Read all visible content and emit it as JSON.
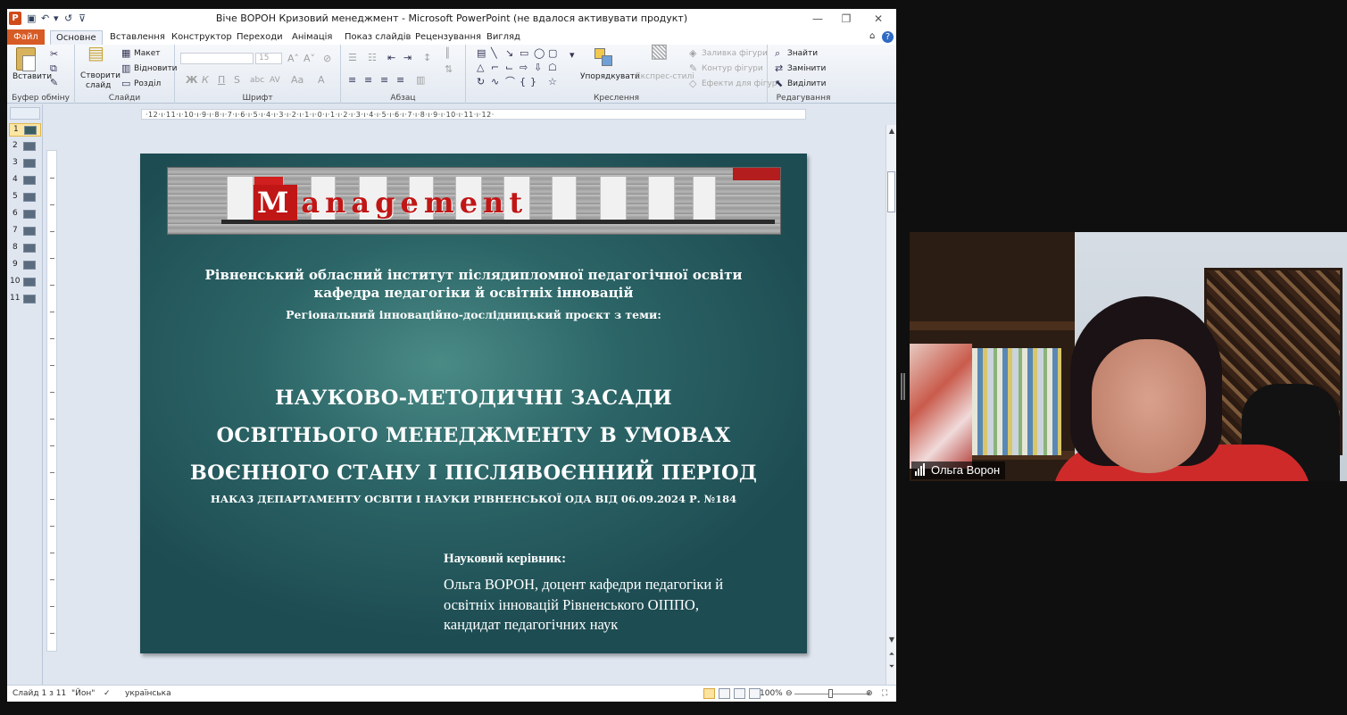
{
  "window": {
    "title": "Віче ВОРОН Кризовий менеджмент  -  Microsoft PowerPoint (не вдалося активувати продукт)",
    "app_icon": "P"
  },
  "tabs": {
    "file": "Файл",
    "items": [
      "Основне",
      "Вставлення",
      "Конструктор",
      "Переходи",
      "Анімація",
      "Показ слайдів",
      "Рецензування",
      "Вигляд"
    ]
  },
  "ribbon": {
    "clipboard": {
      "paste": "Вставити",
      "label": "Буфер обміну"
    },
    "slides": {
      "new_slide_1": "Створити",
      "new_slide_2": "слайд",
      "layout": "Макет",
      "reset": "Відновити",
      "section": "Розділ",
      "label": "Слайди"
    },
    "font": {
      "size": "15",
      "label": "Шрифт"
    },
    "paragraph": {
      "label": "Абзац"
    },
    "drawing": {
      "arrange": "Упорядкувати",
      "quick_styles": "Експрес-стилі",
      "fill": "Заливка фігури",
      "outline": "Контур фігури",
      "effects": "Ефекти для фігур",
      "label": "Креслення"
    },
    "editing": {
      "find": "Знайти",
      "replace": "Замінити",
      "select": "Виділити",
      "label": "Редагування"
    }
  },
  "ruler": "·12·ı·11·ı·10·ı·9·ı·8·ı·7·ı·6·ı·5·ı·4·ı·3·ı·2·ı·1·ı·0·ı·1·ı·2·ı·3·ı·4·ı·5·ı·6·ı·7·ı·8·ı·9·ı·10·ı·11·ı·12·",
  "thumbnails": [
    "1",
    "2",
    "3",
    "4",
    "5",
    "6",
    "7",
    "8",
    "9",
    "10",
    "11"
  ],
  "slide": {
    "banner_text": "anagement",
    "banner_cap": "M",
    "institute_line1": "Рівненський  обласний  інститут  післядипломної педагогічної освіти",
    "institute_line2": "кафедра педагогіки  й освітніх  інновацій",
    "project": "Регіональний інноваційно-дослідницький   проєкт  з теми:",
    "title_line1": "НАУКОВО-МЕТОДИЧНІ ЗАСАДИ",
    "title_line2": "ОСВІТНЬОГО МЕНЕДЖМЕНТУ В УМОВАХ",
    "title_line3": "ВОЄННОГО СТАНУ І ПІСЛЯВОЄННИЙ ПЕРІОД",
    "order": "НАКАЗ ДЕПАРТАМЕНТУ ОСВІТИ І НАУКИ РІВНЕНСЬКОЇ ОДА ВІД 06.09.2024 Р. №184",
    "supervisor_label": "Науковий керівник:",
    "supervisor_text": "Ольга ВОРОН, доцент кафедри педагогіки й\nосвітніх інновацій Рівненського ОІППО,\nкандидат педагогічних наук"
  },
  "status": {
    "slide_counter": "Слайд 1 з 11",
    "theme": "\"Йон\"",
    "language": "українська",
    "zoom": "100%"
  },
  "video": {
    "participant_name": "Ольга Ворон"
  }
}
